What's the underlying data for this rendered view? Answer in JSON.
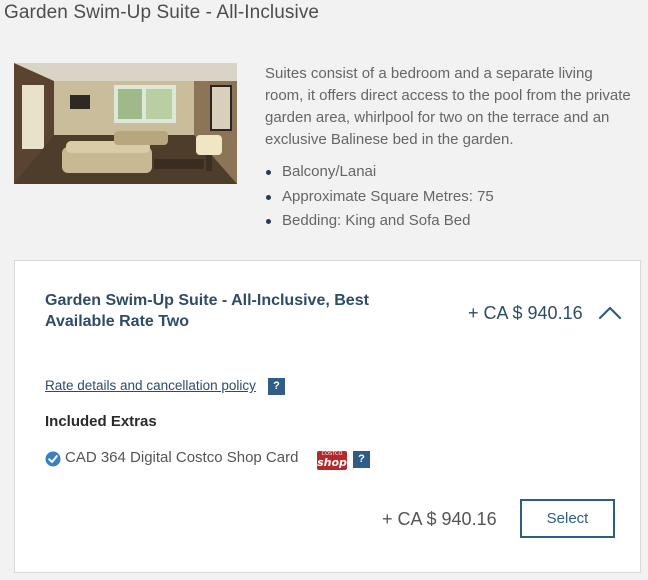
{
  "room": {
    "title": "Garden Swim-Up Suite - All-Inclusive",
    "description": "Suites consist of a bedroom and a separate living room, it offers direct access to the pool from the private garden area, whirlpool for two on the terrace and an exclusive Balinese bed in the garden.",
    "features": [
      "Balcony/Lanai",
      "Approximate Square Metres: 75",
      "Bedding: King and Sofa Bed"
    ]
  },
  "rate": {
    "name": "Garden Swim-Up Suite - All-Inclusive, Best Available Rate Two",
    "price": "+ CA $ 940.16",
    "policy_link": "Rate details and cancellation policy",
    "help_label": "?",
    "extras_heading": "Included Extras",
    "extra_item": "CAD 364 Digital Costco Shop Card",
    "price_bottom": "+ CA $ 940.16",
    "select_label": "Select"
  },
  "colors": {
    "background": "#f2f2f2",
    "card": "#ffffff",
    "accent": "#2f5d86",
    "rate_title": "#2f4c66",
    "check": "#3a7fc4",
    "shop_logo": "#b22a2a"
  },
  "icons": {
    "collapse": "chevron-up-icon",
    "help": "help-icon",
    "check": "check-circle-icon",
    "shop": "costco-shop-card-logo"
  }
}
